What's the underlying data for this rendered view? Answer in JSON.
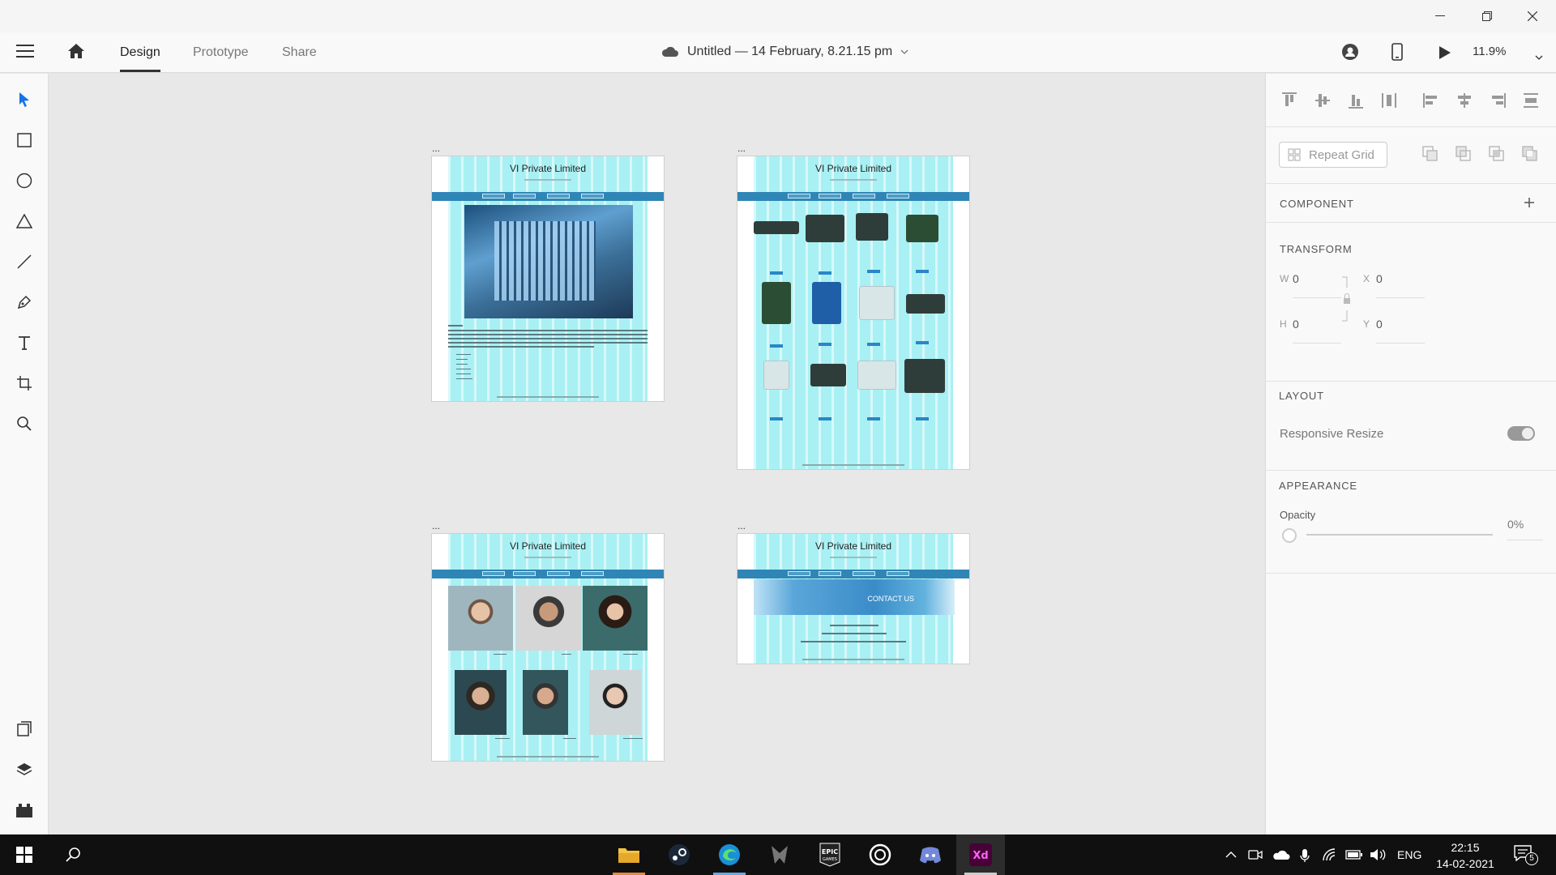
{
  "app": {
    "tabs": [
      "Design",
      "Prototype",
      "Share"
    ],
    "active_tab": "Design",
    "document_title": "Untitled — 14 February, 8.21.15 pm",
    "zoom": "11.9%"
  },
  "artboards": [
    {
      "label": "...",
      "title": "VI Private Limited"
    },
    {
      "label": "...",
      "title": "VI Private Limited"
    },
    {
      "label": "...",
      "title": "VI Private Limited"
    },
    {
      "label": "...",
      "title": "VI Private Limited",
      "banner": "CONTACT US"
    }
  ],
  "panel": {
    "repeat_grid": "Repeat Grid",
    "component": "COMPONENT",
    "transform": "TRANSFORM",
    "w_label": "W",
    "w_value": "0",
    "x_label": "X",
    "x_value": "0",
    "h_label": "H",
    "h_value": "0",
    "y_label": "Y",
    "y_value": "0",
    "layout": "LAYOUT",
    "responsive_resize": "Responsive Resize",
    "responsive_resize_on": true,
    "appearance": "APPEARANCE",
    "opacity_label": "Opacity",
    "opacity_value": "0%"
  },
  "taskbar": {
    "language": "ENG",
    "time": "22:15",
    "date": "14-02-2021",
    "notifications": "5"
  },
  "colors": {
    "artboard_fill": "#a8f0f3",
    "nav_bar": "#2f86b6",
    "xd_brand": "#470137",
    "select_tool": "#1473e6"
  }
}
